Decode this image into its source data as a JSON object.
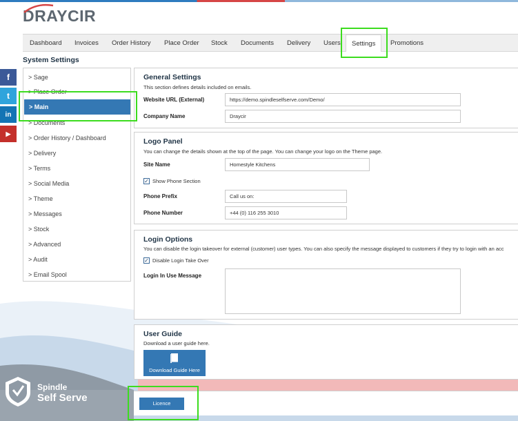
{
  "brand": {
    "logo_text": "DRAYCIR",
    "footer_line1": "Spindle",
    "footer_line2": "Self Serve"
  },
  "nav": {
    "items": [
      "Dashboard",
      "Invoices",
      "Order History",
      "Place Order",
      "Stock",
      "Documents",
      "Delivery",
      "Users",
      "Settings",
      "Promotions"
    ],
    "active": "Settings"
  },
  "page": {
    "title": "System Settings"
  },
  "side_menu": {
    "items": [
      "> Sage",
      "> Place Order",
      "> Main",
      "> Documents",
      "> Order History / Dashboard",
      "> Delivery",
      "> Terms",
      "> Social Media",
      "> Theme",
      "> Messages",
      "> Stock",
      "> Advanced",
      "> Audit",
      "> Email Spool"
    ],
    "active": "> Main"
  },
  "social": {
    "icons": [
      "facebook-icon",
      "twitter-icon",
      "linkedin-icon",
      "youtube-icon"
    ],
    "letters": [
      "f",
      "t",
      "in",
      "▶"
    ]
  },
  "general": {
    "title": "General Settings",
    "desc": "This section defines details included on emails.",
    "website_label": "Website URL (External)",
    "website_value": "https://demo.spindleselfserve.com/Demo/",
    "company_label": "Company Name",
    "company_value": "Draycir"
  },
  "logo_panel": {
    "title": "Logo Panel",
    "desc": "You can change the details shown at the top of the page. You can change your logo on the Theme page.",
    "site_label": "Site Name",
    "site_value": "Homestyle Kitchens",
    "show_phone_label": "Show Phone Section",
    "show_phone_checked": true,
    "prefix_label": "Phone Prefix",
    "prefix_value": "Call us on:",
    "number_label": "Phone Number",
    "number_value": "+44 (0) 116 255 3010"
  },
  "login": {
    "title": "Login Options",
    "desc": "You can disable the login takeover for external (customer) user types. You can also specify the message displayed to customers if they try to login with an acc",
    "disable_label": "Disable Login Take Over",
    "disable_checked": true,
    "message_label": "Login In Use Message",
    "message_value": ""
  },
  "guide": {
    "title": "User Guide",
    "desc": "Download a user guide here.",
    "button": "Download Guide Here"
  },
  "footer": {
    "licence_button": "Licence"
  },
  "colors": {
    "primary": "#3478b4",
    "highlight": "#3cdc1e",
    "accent_red": "#d64545"
  }
}
